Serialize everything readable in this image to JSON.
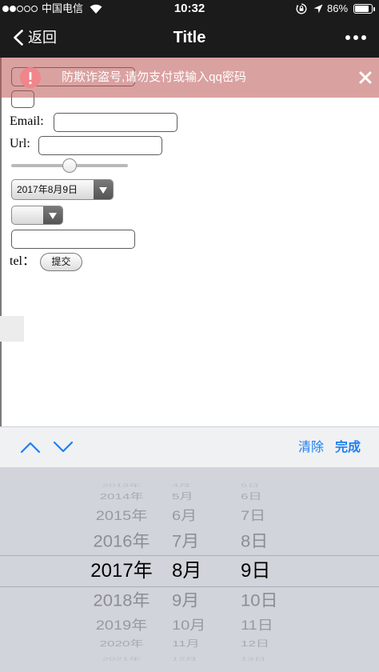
{
  "status_bar": {
    "signal_strength": 2,
    "signal_max": 5,
    "carrier": "中国电信",
    "time": "10:32",
    "battery_text": "86%",
    "battery_level": 0.86,
    "icons": [
      "signal-dots-icon",
      "wifi-icon",
      "rotation-lock-icon",
      "location-arrow-icon",
      "battery-icon"
    ]
  },
  "nav_bar": {
    "back_icon": "chevron-left-icon",
    "back_label": "返回",
    "title": "Title",
    "more_icon": "more-dots-icon"
  },
  "banner": {
    "icon": "warning-icon",
    "message": "防欺诈盗号,请勿支付或输入qq密码",
    "close_icon": "close-icon"
  },
  "form": {
    "top_input": {
      "value": ""
    },
    "small_input": {
      "value": ""
    },
    "email": {
      "label": "Email:",
      "value": ""
    },
    "url": {
      "label": "Url:",
      "value": ""
    },
    "range": {
      "value": 0.5
    },
    "date_select": {
      "value": "2017年8月9日",
      "arrow_icon": "dropdown-arrow-icon"
    },
    "empty_select": {
      "value": "",
      "arrow_icon": "dropdown-arrow-icon"
    },
    "plain_input": {
      "value": ""
    },
    "tel_label": "tel：",
    "submit_label": "提交"
  },
  "accessory_bar": {
    "prev_icon": "chevron-up-icon",
    "next_icon": "chevron-down-icon",
    "clear_label": "清除",
    "done_label": "完成"
  },
  "picker": {
    "years": [
      "2013年",
      "2014年",
      "2015年",
      "2016年",
      "2017年",
      "2018年",
      "2019年",
      "2020年",
      "2021年"
    ],
    "months": [
      "4月",
      "5月",
      "6月",
      "7月",
      "8月",
      "9月",
      "10月",
      "11月",
      "12月"
    ],
    "days": [
      "5日",
      "6日",
      "7日",
      "8日",
      "9日",
      "10日",
      "11日",
      "12日",
      "13日"
    ],
    "selected_index": 4
  },
  "colors": {
    "bar_background": "#1b1b1b",
    "accent": "#1d7ff2",
    "banner_tint": "#bc54548c",
    "warning": "#ef868c",
    "picker_background": "#d1d4da",
    "accessory_background": "#f0f1f3"
  }
}
